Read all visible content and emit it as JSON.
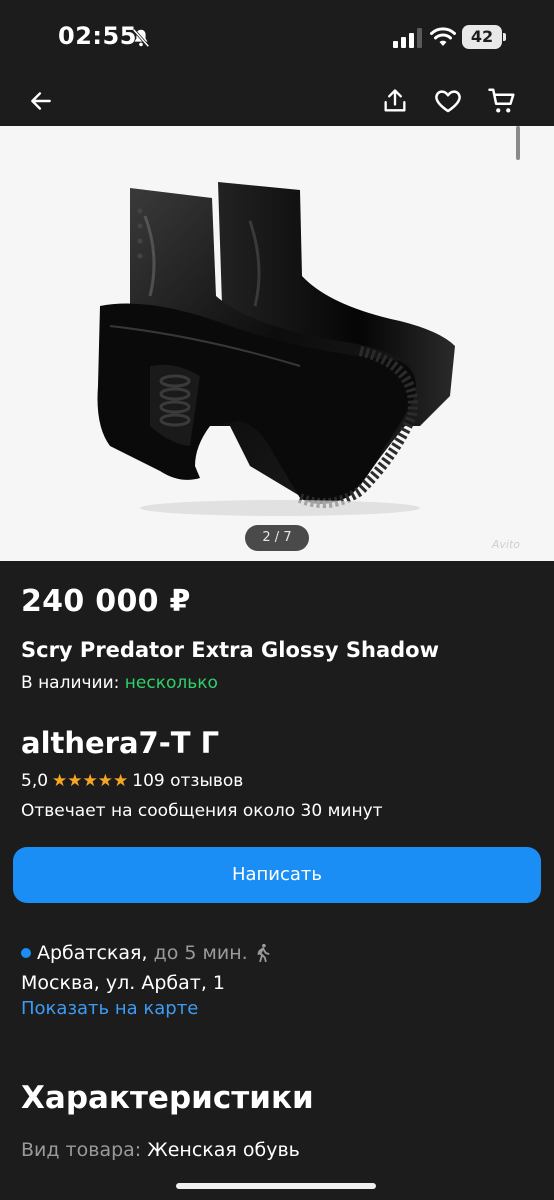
{
  "status_bar": {
    "time": "02:55",
    "battery": "42"
  },
  "gallery": {
    "page_indicator": "2 / 7",
    "watermark": "Avito"
  },
  "listing": {
    "price": "240 000 ₽",
    "title": "Scry Predator Extra Glossy Shadow",
    "availability_label": "В наличии:",
    "availability_value": "несколько"
  },
  "seller": {
    "name": "althera7-Т Г",
    "rating": "5,0",
    "stars": "★★★★★",
    "reviews": "109 отзывов",
    "response_time": "Отвечает на сообщения около 30 минут"
  },
  "actions": {
    "write_label": "Написать"
  },
  "location": {
    "metro_station": "Арбатская,",
    "metro_time": "до 5 мин.",
    "address": "Москва, ул. Арбат, 1",
    "map_link": "Показать на карте"
  },
  "characteristics": {
    "title": "Характеристики",
    "items": [
      {
        "label": "Вид товара:",
        "value": "Женская обувь"
      }
    ]
  },
  "colors": {
    "background": "#1c1c1c",
    "accent_blue": "#1a8ef5",
    "link_blue": "#3c9cf5",
    "in_stock_green": "#2fd06a",
    "star_orange": "#f5a623"
  }
}
